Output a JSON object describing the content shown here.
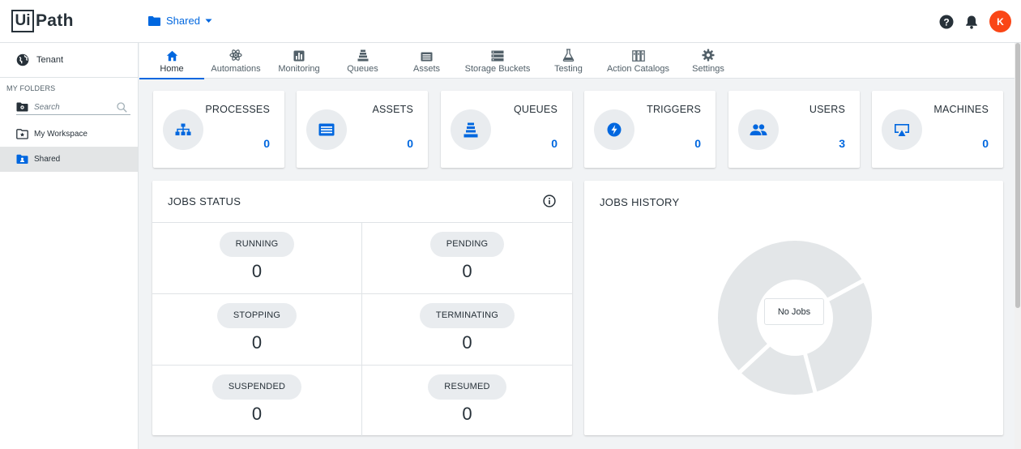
{
  "header": {
    "logo_box": "Ui",
    "logo_text": "Path",
    "folder": "Shared",
    "avatar_initial": "K",
    "avatar_color": "#fa4616",
    "accent_color": "#0067df"
  },
  "sidebar": {
    "tenant": "Tenant",
    "section_title": "MY FOLDERS",
    "search_placeholder": "Search",
    "folders": [
      {
        "label": "My Workspace",
        "icon": "workspace-star-folder-icon"
      },
      {
        "label": "Shared",
        "icon": "shared-folder-icon",
        "selected": true
      }
    ]
  },
  "nav": {
    "tabs": [
      {
        "label": "Home",
        "icon": "home-icon",
        "active": true
      },
      {
        "label": "Automations",
        "icon": "automations-icon"
      },
      {
        "label": "Monitoring",
        "icon": "monitoring-icon"
      },
      {
        "label": "Queues",
        "icon": "queues-icon"
      },
      {
        "label": "Assets",
        "icon": "assets-icon"
      },
      {
        "label": "Storage Buckets",
        "icon": "storage-buckets-icon"
      },
      {
        "label": "Testing",
        "icon": "testing-flask-icon"
      },
      {
        "label": "Action Catalogs",
        "icon": "action-catalogs-icon"
      },
      {
        "label": "Settings",
        "icon": "settings-gear-icon"
      }
    ]
  },
  "stats": [
    {
      "title": "PROCESSES",
      "value": "0",
      "icon": "processes-icon"
    },
    {
      "title": "ASSETS",
      "value": "0",
      "icon": "assets-icon"
    },
    {
      "title": "QUEUES",
      "value": "0",
      "icon": "queues-icon"
    },
    {
      "title": "TRIGGERS",
      "value": "0",
      "icon": "triggers-icon"
    },
    {
      "title": "USERS",
      "value": "3",
      "icon": "users-icon"
    },
    {
      "title": "MACHINES",
      "value": "0",
      "icon": "machines-icon"
    }
  ],
  "jobs_status": {
    "title": "JOBS STATUS",
    "items": [
      {
        "label": "RUNNING",
        "value": "0"
      },
      {
        "label": "PENDING",
        "value": "0"
      },
      {
        "label": "STOPPING",
        "value": "0"
      },
      {
        "label": "TERMINATING",
        "value": "0"
      },
      {
        "label": "SUSPENDED",
        "value": "0"
      },
      {
        "label": "RESUMED",
        "value": "0"
      }
    ]
  },
  "jobs_history": {
    "title": "JOBS HISTORY",
    "empty_label": "No Jobs"
  }
}
